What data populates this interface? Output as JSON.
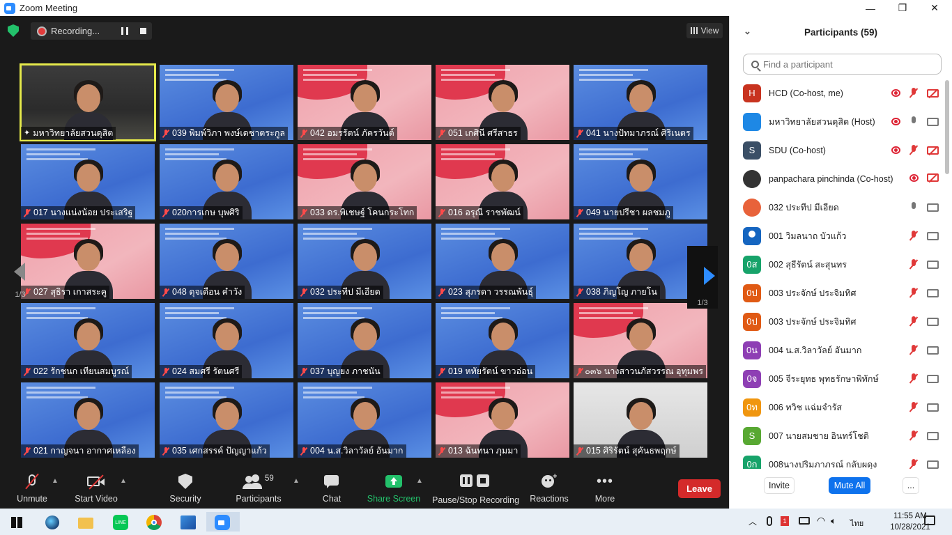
{
  "window": {
    "title": "Zoom Meeting",
    "minimize_glyph": "—",
    "restore_glyph": "❐",
    "close_glyph": "✕"
  },
  "recording": {
    "label": "Recording..."
  },
  "view": {
    "label": "View"
  },
  "gallery": {
    "page_indicator": "1/3",
    "tiles": [
      {
        "name": "มหาวิทยาลัยสวนดุสิต",
        "style": "room",
        "active": true,
        "icon": "pin-icon"
      },
      {
        "name": "039 พิมพ์วิภา  พงษ์เดชาตระกูล",
        "style": "blue"
      },
      {
        "name": "042 อมรรัตน์ ภัครวันต์",
        "style": "pink"
      },
      {
        "name": "051 เกศินี ศรีสาธร",
        "style": "pink"
      },
      {
        "name": "041 นางปัทมาภรณ์ ศิริเนตร",
        "style": "blue"
      },
      {
        "name": "017 นางแน่งน้อย ประเสริฐ",
        "style": "blue"
      },
      {
        "name": "020การเกษ บุพศิริ",
        "style": "blue"
      },
      {
        "name": "033 ดร.พิเชษฐ์  โคนกระโทก",
        "style": "pink"
      },
      {
        "name": "016 อรุณี  ราชพัฒน์",
        "style": "pink"
      },
      {
        "name": "049 นายปรีชา ผลชมภู",
        "style": "blue"
      },
      {
        "name": "027 สุธิรา เกาสระคู",
        "style": "pink"
      },
      {
        "name": "048 ดุจเดือน คำวัง",
        "style": "blue"
      },
      {
        "name": "032 ประทีป มีเอียด",
        "style": "blue"
      },
      {
        "name": "023 สุภรดา  วรรณพันธุ์",
        "style": "blue"
      },
      {
        "name": "038  ภิญโญ ภายโน",
        "style": "blue"
      },
      {
        "name": "022 รักชนก เทียนสมบูรณ์",
        "style": "blue"
      },
      {
        "name": "024 สมศรี รัตนศรี",
        "style": "blue"
      },
      {
        "name": "037 บุญยง ภาชนัน",
        "style": "blue"
      },
      {
        "name": "019 หทัยรัตน์ ขาวอ่อน",
        "style": "blue"
      },
      {
        "name": "๐๓๖ นางสาวนภัสวรรณ อุทุมพร",
        "style": "pink"
      },
      {
        "name": "021 กาญจนา อากาศเหลือง",
        "style": "blue"
      },
      {
        "name": "035 เศกสรรค์ ปัญญาแก้ว",
        "style": "blue"
      },
      {
        "name": "004 น.ส.วิลาวัลย์ อันมาก",
        "style": "blue"
      },
      {
        "name": "013 ฉันทนา  ภุมมา",
        "style": "pink"
      },
      {
        "name": "015 ศิริรัตน์  สุคันธพฤกษ์",
        "style": "photo"
      }
    ]
  },
  "toolbar": {
    "unmute": "Unmute",
    "start_video": "Start Video",
    "security": "Security",
    "participants": "Participants",
    "participants_count": "59",
    "chat": "Chat",
    "share_screen": "Share Screen",
    "pause_stop_recording": "Pause/Stop Recording",
    "reactions": "Reactions",
    "more": "More",
    "leave": "Leave",
    "colors": {
      "share_green": "#23c16b",
      "leave_red": "#d42a2a"
    }
  },
  "panel": {
    "title": "Participants (59)",
    "search_placeholder": "Find a participant",
    "participants": [
      {
        "initials": "H",
        "color": "#c8331f",
        "name": "HCD (Co-host, me)",
        "rec": true,
        "mic": "muted",
        "cam": "off"
      },
      {
        "initials": "",
        "color": "#1e88e5",
        "name": "มหาวิทยาลัยสวนดุสิต (Host)",
        "rec": true,
        "mic": "on",
        "cam": "on",
        "icon": "university-logo-icon"
      },
      {
        "initials": "S",
        "color": "#3b4f66",
        "name": "SDU (Co-host)",
        "rec": true,
        "mic": "muted",
        "cam": "off"
      },
      {
        "initials": "",
        "color": "#333333",
        "name": "panpachara pinchinda (Co-host)",
        "rec": true,
        "mic": "none",
        "cam": "off",
        "icon": "photo-avatar-icon"
      },
      {
        "initials": "",
        "color": "#e8623a",
        "name": "032 ประทีป มีเอียด",
        "rec": false,
        "mic": "on",
        "cam": "on",
        "icon": "photo-avatar-icon"
      },
      {
        "initials": "",
        "color": "#1565c0",
        "name": "001 วิมลนาถ บัวแก้ว",
        "rec": false,
        "mic": "muted",
        "cam": "on",
        "icon": "person-avatar-icon"
      },
      {
        "initials": "0ส",
        "color": "#17a36a",
        "name": "002 สุธีรัตน์  สะสุนทร",
        "rec": false,
        "mic": "muted",
        "cam": "on"
      },
      {
        "initials": "0ป",
        "color": "#e05a14",
        "name": "003 ประจักษ์  ประจิมทิศ",
        "rec": false,
        "mic": "muted",
        "cam": "on"
      },
      {
        "initials": "0ป",
        "color": "#e05a14",
        "name": "003 ประจักษ์ ประจิมทิศ",
        "rec": false,
        "mic": "muted",
        "cam": "on"
      },
      {
        "initials": "0น",
        "color": "#8e3fb4",
        "name": "004 น.ส.วิลาวัลย์ อันมาก",
        "rec": false,
        "mic": "muted",
        "cam": "on"
      },
      {
        "initials": "0จ",
        "color": "#8e3fb4",
        "name": "005 จีระยุทธ พุทธรักษาพิทักษ์",
        "rec": false,
        "mic": "muted",
        "cam": "on"
      },
      {
        "initials": "0ท",
        "color": "#f0960f",
        "name": "006 ทวิช  แฉ่มจำรัส",
        "rec": false,
        "mic": "muted",
        "cam": "on"
      },
      {
        "initials": "S",
        "color": "#58a832",
        "name": "007 นายสมชาย อินทร์โชติ",
        "rec": false,
        "mic": "muted",
        "cam": "on"
      },
      {
        "initials": "0ก",
        "color": "#17a36a",
        "name": "008นางปริมภาภรณ์ กลับผดุง",
        "rec": false,
        "mic": "muted",
        "cam": "on"
      }
    ],
    "invite": "Invite",
    "mute_all": "Mute All",
    "more": "...",
    "accent": "#0e72ed"
  },
  "taskbar": {
    "time": "11:55 AM",
    "date": "10/28/2021",
    "lang": "ไทย",
    "notification_badge": "1"
  }
}
